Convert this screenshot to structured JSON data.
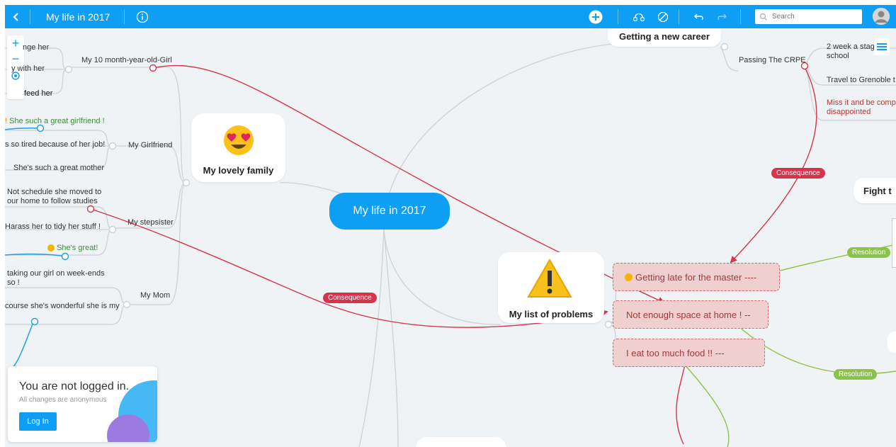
{
  "header": {
    "title": "My life in 2017",
    "search_placeholder": "Search",
    "back_icon": "chevron-left-icon",
    "info_icon": "info-icon",
    "add_icon": "plus-circle-icon",
    "link_icon": "connect-icon",
    "cancel_icon": "cancel-icon",
    "undo_icon": "undo-icon",
    "redo_icon": "redo-icon",
    "avatar_icon": "user-avatar-icon"
  },
  "colors": {
    "brand": "#0e9ef3",
    "consequence": "#d6344a",
    "resolution": "#8bc34a",
    "problem_fill": "#efcfd0"
  },
  "central": {
    "label": "My life in 2017"
  },
  "family": {
    "title": "My lovely family",
    "child_label": "My 10 month-year-old-Girl",
    "child_items": [
      "nge her",
      "y with her",
      "feed her"
    ],
    "girlfriend_label": "My Girlfriend",
    "girlfriend_items": [
      "She such a great girlfriend !",
      "s so tired because of her job!",
      "She's such a great mother"
    ],
    "stepsister_label": "My stepsister",
    "stepsister_items": [
      "Not schedule she moved to our home to follow studies",
      "Harass her to tidy her stuff !",
      "She's great!"
    ],
    "mom_label": "My Mom",
    "mom_items": [
      "taking our girl on week-ends so !",
      "course she's wonderful she is my"
    ]
  },
  "career": {
    "title": "Getting a new career",
    "crpe_label": "Passing The CRPE",
    "crpe_items": [
      "2 week a stage school",
      "Travel to Grenoble t",
      "Miss it and be comp disappointed"
    ]
  },
  "problems": {
    "title": "My list of problems",
    "items": [
      "Getting late for the master ----",
      "Not enough space at home ! --",
      "I eat too much food !! ---"
    ]
  },
  "fight": {
    "title": "Fight t"
  },
  "relations": {
    "consequence": "Consequence",
    "resolution": "Resolution"
  },
  "zoom_controls": {
    "zoom_in": "+",
    "zoom_out": "−",
    "center_icon": "locate-icon"
  },
  "login_panel": {
    "title": "You are not logged in.",
    "subtitle": "All changes are anonymous",
    "button": "Log In"
  }
}
